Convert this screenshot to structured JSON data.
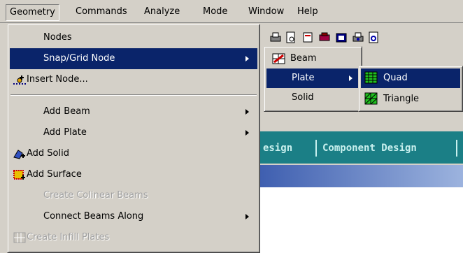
{
  "menubar": {
    "items": [
      {
        "label": "Geometry",
        "active": true
      },
      {
        "label": "Commands"
      },
      {
        "label": "Analyze"
      },
      {
        "label": "Mode"
      },
      {
        "label": "Window"
      },
      {
        "label": "Help"
      }
    ]
  },
  "geometry_menu": {
    "items": [
      {
        "label": "Nodes",
        "mnemonic": "N"
      },
      {
        "label": "Snap/Grid Node",
        "mnemonic": "a",
        "submenu": true,
        "highlighted": true
      },
      {
        "label": "Insert Node...",
        "mnemonic": "I",
        "icon": "insert-node-icon"
      },
      {
        "label": "Add Beam",
        "submenu": true
      },
      {
        "label": "Add Plate",
        "submenu": true
      },
      {
        "label": "Add Solid",
        "icon": "add-solid-icon"
      },
      {
        "label": "Add Surface",
        "icon": "add-surface-icon"
      },
      {
        "label": "Create Colinear Beams",
        "disabled": true
      },
      {
        "label": "Connect Beams Along",
        "submenu": true
      },
      {
        "label": "Create Infill Plates",
        "disabled": true,
        "icon": "infill-plates-icon"
      }
    ]
  },
  "snap_submenu": {
    "items": [
      {
        "label": "Beam",
        "icon": "beam-icon"
      },
      {
        "label": "Plate",
        "submenu": true,
        "highlighted": true
      },
      {
        "label": "Solid"
      }
    ]
  },
  "plate_submenu": {
    "items": [
      {
        "label": "Quad",
        "icon": "quad-icon",
        "highlighted": true
      },
      {
        "label": "Triangle",
        "icon": "triangle-icon"
      }
    ]
  },
  "workspace": {
    "tabs": [
      "esign",
      "Component Design"
    ]
  },
  "colors": {
    "menu_bg": "#d4d0c8",
    "highlight": "#0a246a",
    "teal_bar": "#1b7f86",
    "title_gradient_start": "#3f5fb0"
  }
}
